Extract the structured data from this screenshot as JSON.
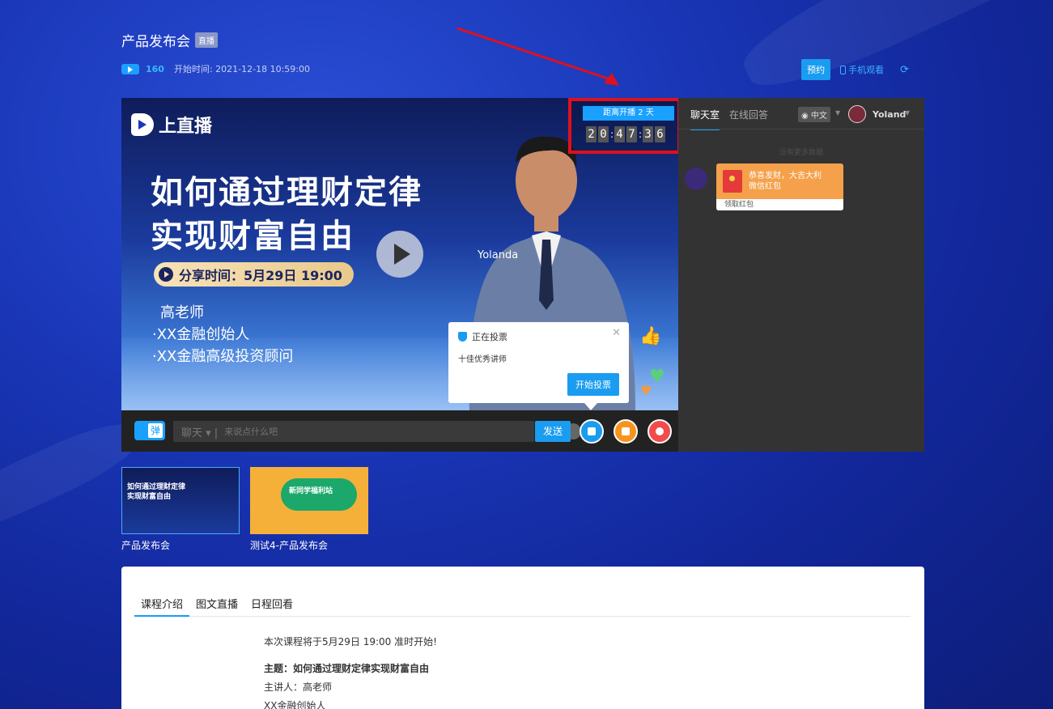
{
  "header": {
    "title": "产品发布会",
    "live_tag": "直播",
    "view_count": "160",
    "start_time": "开始时间: 2021-12-18 10:59:00",
    "reserve_label": "预约",
    "mobile_label": "手机观看"
  },
  "video": {
    "logo_text": "上直播",
    "headline_1": "如何通过理财定律",
    "headline_2": "实现财富自由",
    "share_time": "分享时间：5月29日 19:00",
    "teacher_name": "高老师",
    "teacher_line_1": "·XX金融创始人",
    "teacher_line_2": "·XX金融高级投资顾问",
    "presenter": "Yolanda"
  },
  "countdown": {
    "label": "距离开播 2 天",
    "digits": [
      "2",
      "0",
      "4",
      "7",
      "3",
      "6"
    ]
  },
  "vote": {
    "title": "正在投票",
    "item": "十佳优秀讲师",
    "button": "开始投票"
  },
  "bar": {
    "danmu": "弹",
    "mode": "聊天",
    "placeholder": "来说点什么吧",
    "send": "发送"
  },
  "chat": {
    "tabs": [
      "聊天室",
      "在线回答"
    ],
    "lang": "中文",
    "user": "Yoland",
    "no_more": "没有更多数据",
    "redpacket_text_1": "恭喜发财，大吉大利",
    "redpacket_text_2": "微信红包",
    "redpacket_foot": "领取红包"
  },
  "thumbs": [
    {
      "caption": "产品发布会",
      "mini_1": "如何通过理财定律",
      "mini_2": "实现财富自由"
    },
    {
      "caption": "测试4-产品发布会",
      "mini": "新同学福利站"
    }
  ],
  "content": {
    "tabs": [
      "课程介绍",
      "图文直播",
      "日程回看"
    ],
    "line_1": "本次课程将于5月29日 19:00 准时开始!",
    "subject": "主题：如何通过理财定律实现财富自由",
    "speaker": "主讲人：高老师",
    "speaker_title": "XX金融创始人"
  },
  "colors": {
    "accent": "#1a9cf0",
    "highlight_border": "#e0101c",
    "chat_bg": "#333333"
  }
}
